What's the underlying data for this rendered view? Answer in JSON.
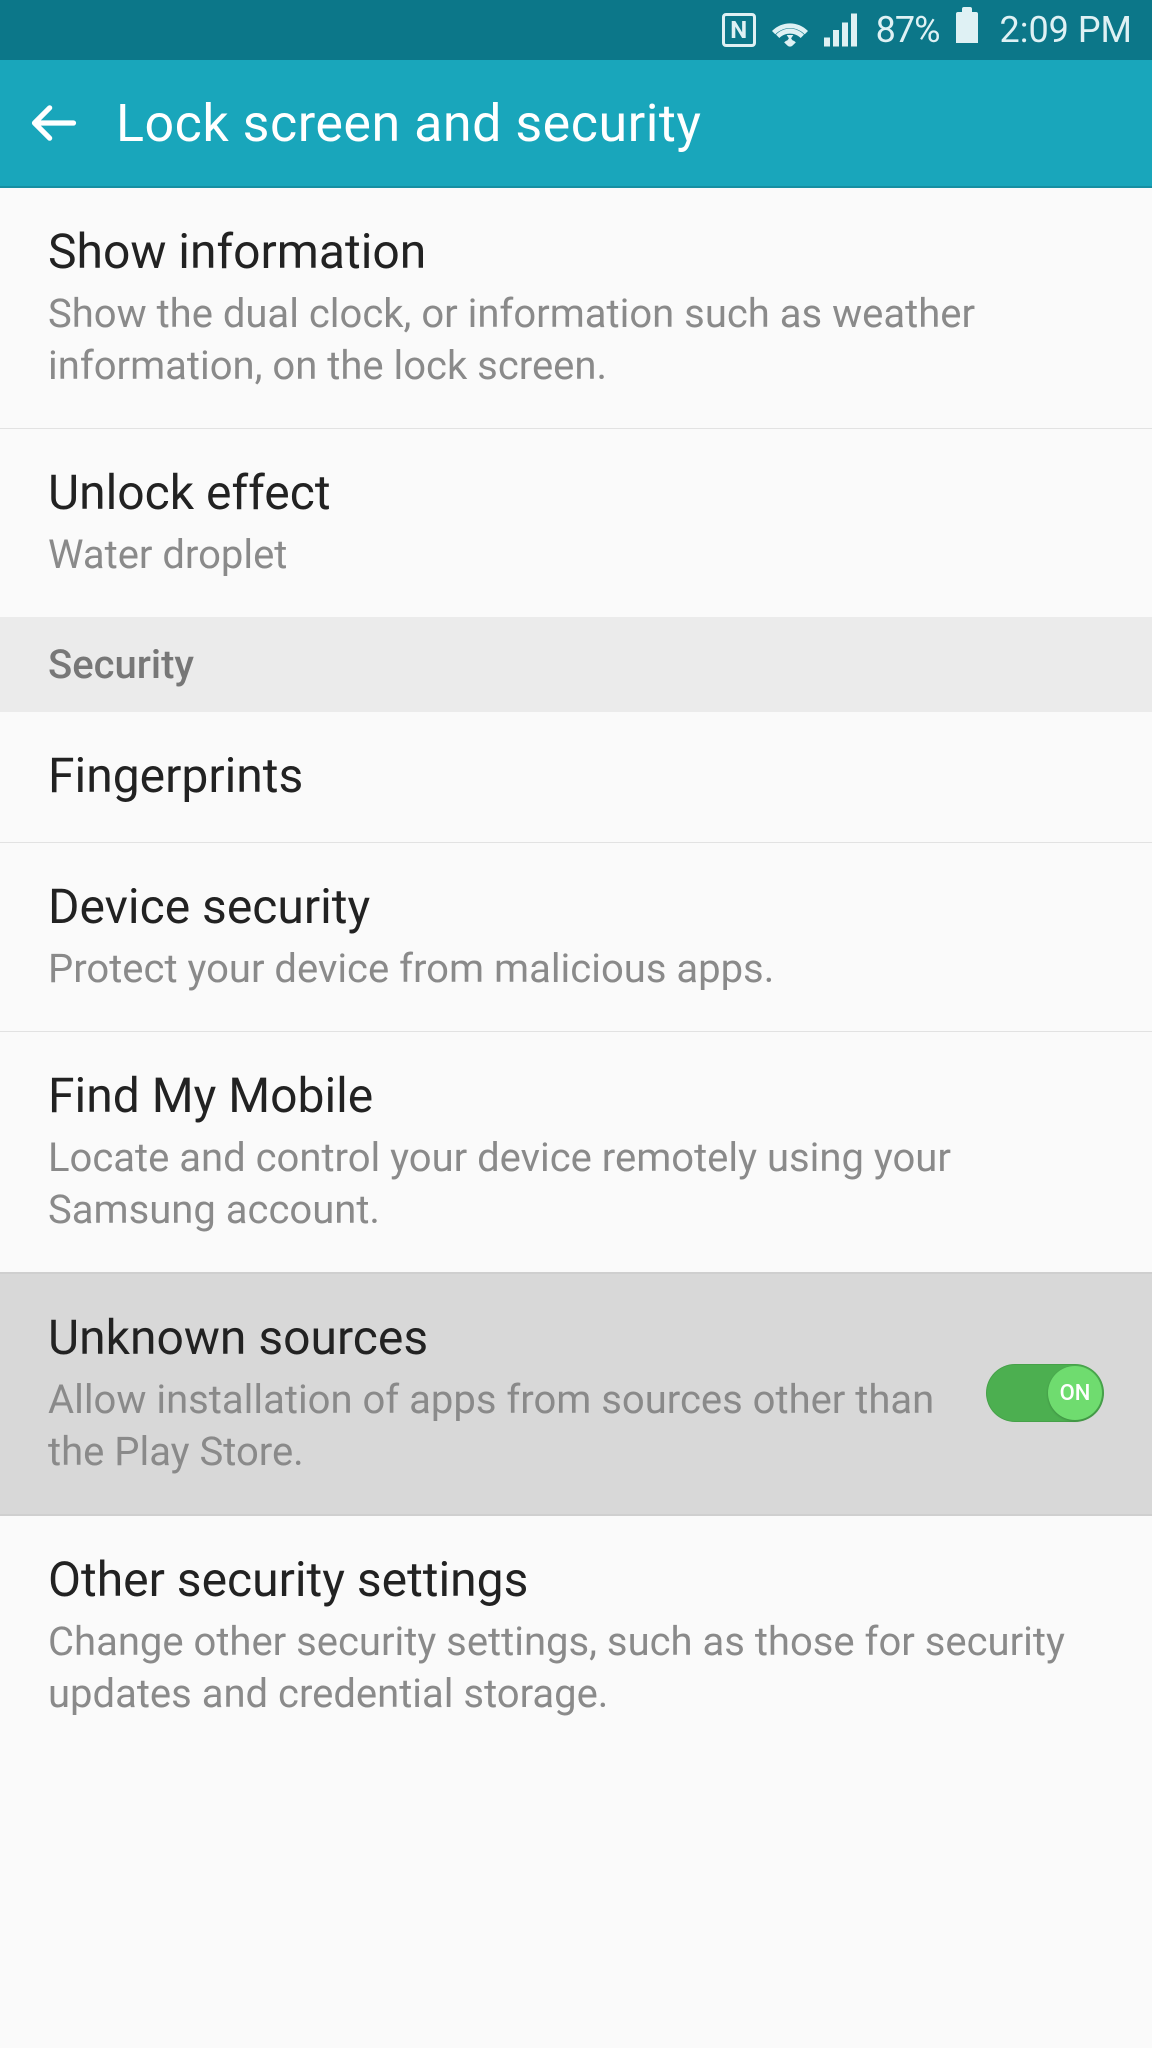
{
  "status": {
    "battery_percent": "87%",
    "time": "2:09 PM"
  },
  "header": {
    "title": "Lock screen and security"
  },
  "items": {
    "show_info": {
      "title": "Show information",
      "sub": "Show the dual clock, or information such as weather information, on the lock screen."
    },
    "unlock_effect": {
      "title": "Unlock effect",
      "sub": "Water droplet"
    },
    "fingerprints": {
      "title": "Fingerprints"
    },
    "device_security": {
      "title": "Device security",
      "sub": "Protect your device from malicious apps."
    },
    "find_my_mobile": {
      "title": "Find My Mobile",
      "sub": "Locate and control your device remotely using your Samsung account."
    },
    "unknown_sources": {
      "title": "Unknown sources",
      "sub": "Allow installation of apps from sources other than the Play Store.",
      "toggle_label": "ON",
      "toggle_on": true
    },
    "other_security": {
      "title": "Other security settings",
      "sub": "Change other security settings, such as those for security updates and credential storage."
    }
  },
  "sections": {
    "security": "Security"
  }
}
